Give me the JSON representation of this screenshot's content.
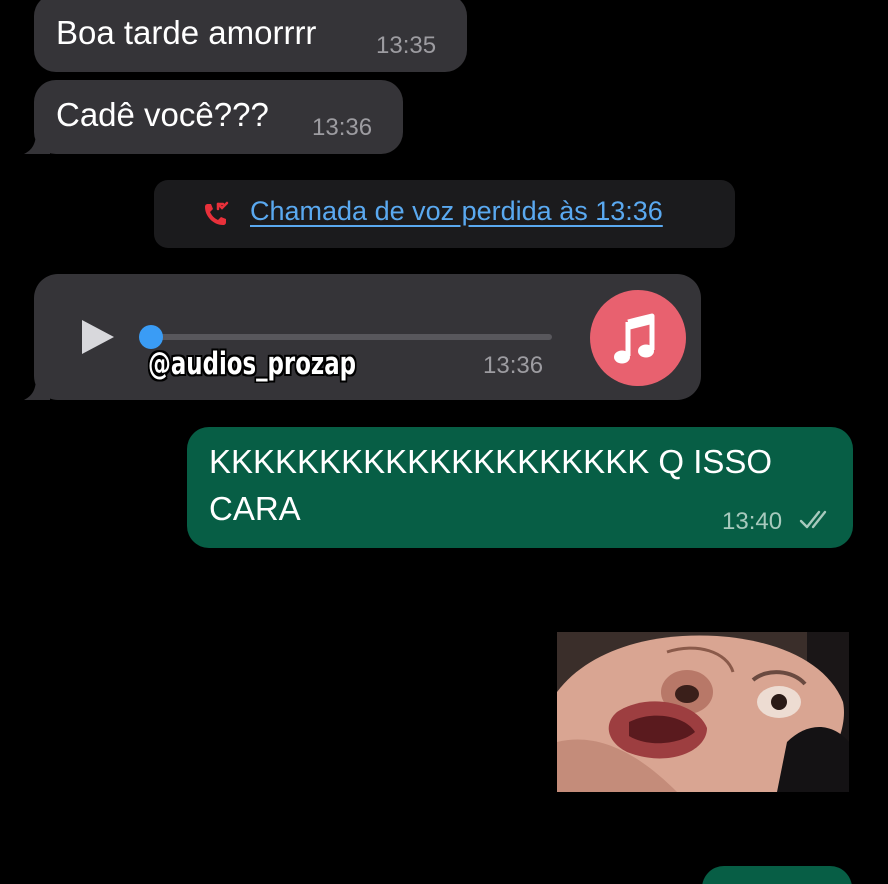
{
  "messages": {
    "msg1": {
      "text": "Boa tarde amorrrr",
      "time": "13:35"
    },
    "msg2": {
      "text": "Cadê você???",
      "time": "13:36"
    },
    "missed_call": {
      "text": "Chamada de voz perdida às 13:36",
      "icon": "missed-call-icon"
    },
    "audio": {
      "time": "13:36",
      "watermark": "@audios_prozap",
      "progress": 0,
      "icon": "music-note-icon"
    },
    "msg3": {
      "line1": "KKKKKKKKKKKKKKKKKKKK Q ISSO",
      "line2": "CARA",
      "time": "13:40",
      "status_icon": "double-check-icon"
    }
  },
  "colors": {
    "background": "#000000",
    "incoming_bubble": "#353438",
    "outgoing_bubble": "#075e45",
    "link_blue": "#5aa9f0",
    "missed_call_red": "#e8303a",
    "audio_progress_blue": "#3a9cf5",
    "music_circle": "#e8616f"
  }
}
